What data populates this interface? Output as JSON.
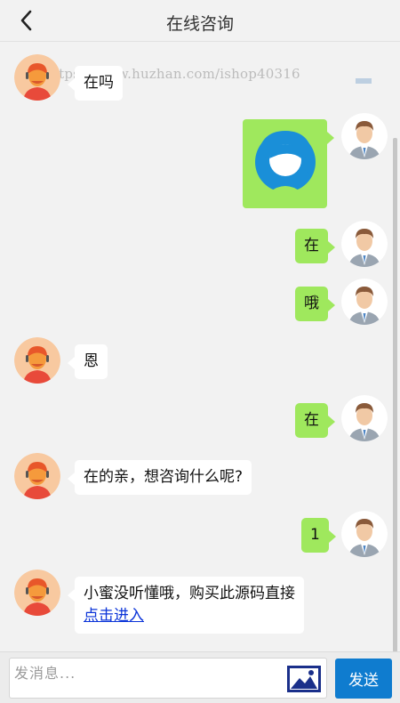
{
  "header": {
    "title": "在线咨询"
  },
  "watermark": "https://www.huzhan.com/ishop40316",
  "messages": [
    {
      "from": "agent",
      "text": "在吗"
    },
    {
      "from": "user",
      "type": "image",
      "image": "customer-service-headset-icon"
    },
    {
      "from": "user",
      "text": "在"
    },
    {
      "from": "user",
      "text": "哦"
    },
    {
      "from": "agent",
      "text": "恩"
    },
    {
      "from": "user",
      "text": "在"
    },
    {
      "from": "agent",
      "text": "在的亲，想咨询什么呢?"
    },
    {
      "from": "user",
      "text": "1"
    },
    {
      "from": "agent",
      "text": "小蜜没听懂哦，购买此源码直接",
      "link": "点击进入"
    }
  ],
  "composer": {
    "placeholder": "发消息...",
    "send_label": "发送",
    "image_icon": "image-upload-icon"
  },
  "colors": {
    "user_bubble": "#9fe85d",
    "agent_bubble": "#ffffff",
    "send_button": "#0f7ccf",
    "background": "#f2f2f2"
  }
}
